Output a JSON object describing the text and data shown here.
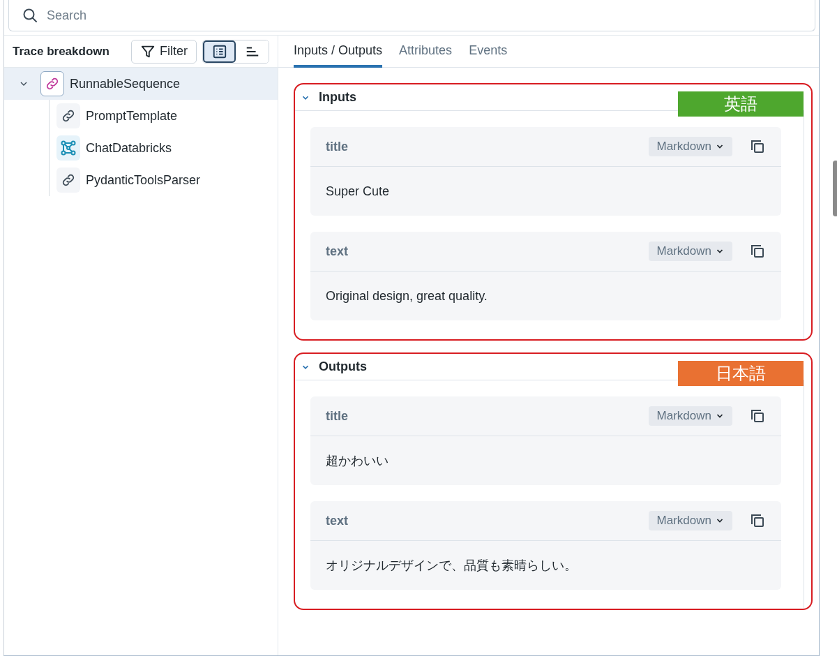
{
  "search": {
    "placeholder": "Search"
  },
  "sidebar": {
    "title": "Trace breakdown",
    "filter_button": "Filter",
    "view_toggles": [
      {
        "kind": "list",
        "selected": true
      },
      {
        "kind": "timeline",
        "selected": false
      }
    ],
    "tree": [
      {
        "label": "RunnableSequence",
        "kind": "chain",
        "selected": true,
        "expanded": true,
        "children": [
          {
            "label": "PromptTemplate",
            "kind": "chain",
            "selected": false
          },
          {
            "label": "ChatDatabricks",
            "kind": "model",
            "selected": false
          },
          {
            "label": "PydanticToolsParser",
            "kind": "chain",
            "selected": false
          }
        ]
      }
    ]
  },
  "tabs": [
    {
      "label": "Inputs / Outputs",
      "selected": true
    },
    {
      "label": "Attributes",
      "selected": false
    },
    {
      "label": "Events",
      "selected": false
    }
  ],
  "sections": [
    {
      "title": "Inputs",
      "expanded": true,
      "annotation": {
        "label": "英語",
        "color": "#4ea72e"
      },
      "fields": [
        {
          "name": "title",
          "format": "Markdown",
          "value": "Super Cute"
        },
        {
          "name": "text",
          "format": "Markdown",
          "value": "Original design, great quality."
        }
      ]
    },
    {
      "title": "Outputs",
      "expanded": true,
      "annotation": {
        "label": "日本語",
        "color": "#e97132"
      },
      "fields": [
        {
          "name": "title",
          "format": "Markdown",
          "value": "超かわいい"
        },
        {
          "name": "text",
          "format": "Markdown",
          "value": "オリジナルデザインで、品質も素晴らしい。"
        }
      ]
    }
  ]
}
